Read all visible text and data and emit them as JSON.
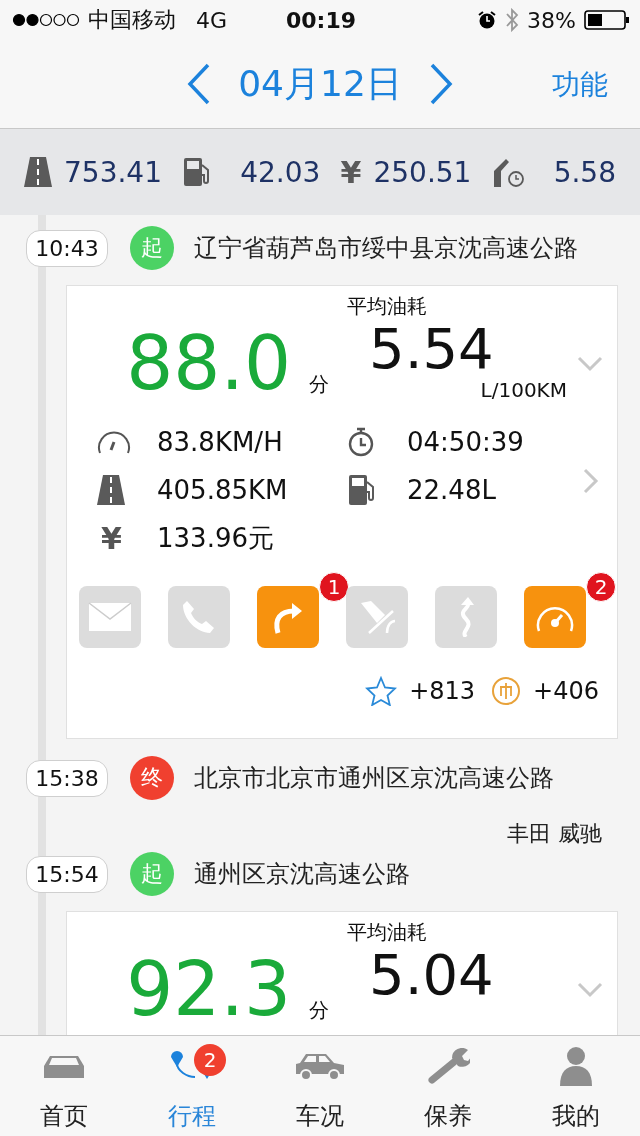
{
  "status_bar": {
    "carrier": "中国移动",
    "network": "4G",
    "time": "00:19",
    "battery": "38%"
  },
  "nav": {
    "date": "04月12日",
    "action": "功能"
  },
  "summary": [
    {
      "kind": "road",
      "value": "753.41"
    },
    {
      "kind": "fuel",
      "value": "42.03"
    },
    {
      "kind": "yen",
      "symbol": "¥",
      "value": "250.51"
    },
    {
      "kind": "fuel-time",
      "value": "5.58"
    }
  ],
  "timeline": [
    {
      "kind": "event",
      "time": "10:43",
      "color": "#4cd264",
      "marker_label": "起",
      "address": "辽宁省葫芦岛市绥中县京沈高速公路"
    },
    {
      "kind": "trip",
      "score": "88.0",
      "score_unit": "分",
      "consumption_label": "平均油耗",
      "consumption": "5.54",
      "consumption_unit": "L/100KM",
      "stats": [
        {
          "kind": "speed",
          "value": "83.8KM/H"
        },
        {
          "kind": "timer",
          "value": "04:50:39"
        },
        {
          "kind": "road",
          "value": "405.85KM"
        },
        {
          "kind": "fuel",
          "value": "22.48L"
        },
        {
          "kind": "yen",
          "symbol": "¥",
          "value": "133.96元"
        }
      ],
      "actions": [
        {
          "kind": "mail",
          "active": false
        },
        {
          "kind": "phone",
          "active": false
        },
        {
          "kind": "turn",
          "active": true,
          "badge": "1"
        },
        {
          "kind": "pedal",
          "active": false
        },
        {
          "kind": "curve",
          "active": false
        },
        {
          "kind": "gauge",
          "active": true,
          "badge": "2"
        }
      ],
      "points": "+813",
      "coins": "+406"
    },
    {
      "kind": "event",
      "time": "15:38",
      "color": "#f0402f",
      "marker_label": "终",
      "address": "北京市北京市通州区京沈高速公路"
    },
    {
      "kind": "car",
      "text": "丰田 威驰"
    },
    {
      "kind": "event",
      "time": "15:54",
      "color": "#4cd264",
      "marker_label": "起",
      "address": "通州区京沈高速公路"
    },
    {
      "kind": "trip",
      "score": "92.3",
      "score_unit": "分",
      "consumption_label": "平均油耗",
      "consumption": "5.04"
    }
  ],
  "tabs": [
    {
      "kind": "sportscar",
      "label": "首页",
      "selected": false
    },
    {
      "kind": "route",
      "label": "行程",
      "selected": true,
      "badge": "2"
    },
    {
      "kind": "car",
      "label": "车况",
      "selected": false
    },
    {
      "kind": "wrench",
      "label": "保养",
      "selected": false
    },
    {
      "kind": "person",
      "label": "我的",
      "selected": false
    }
  ]
}
